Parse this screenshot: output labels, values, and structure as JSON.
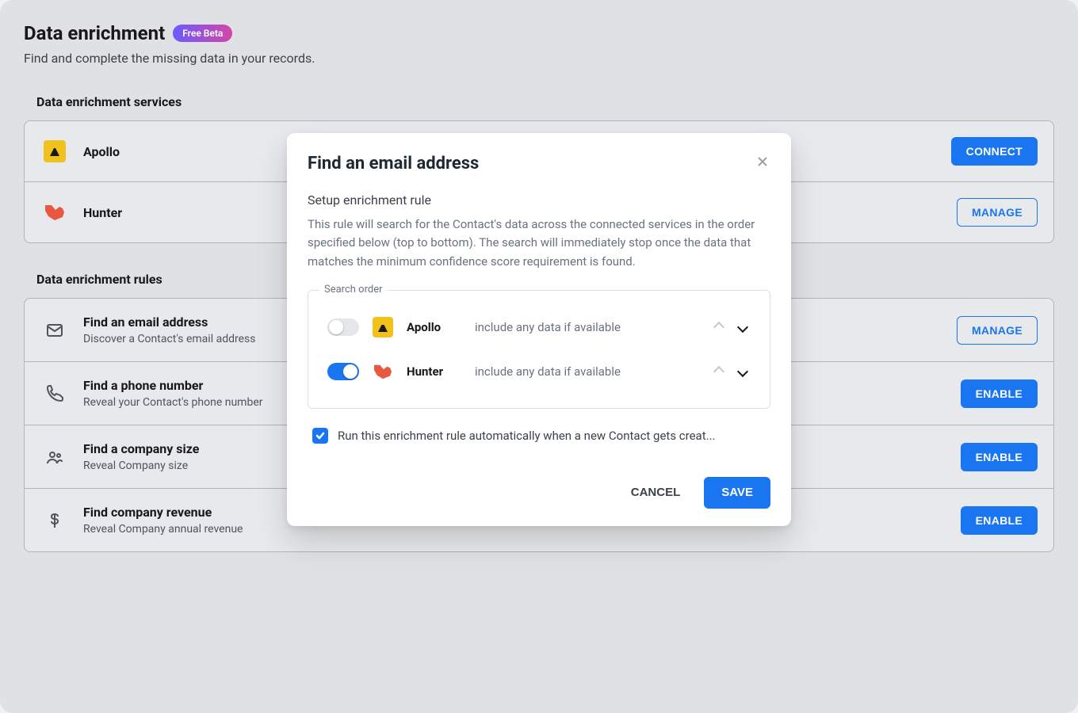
{
  "header": {
    "title": "Data enrichment",
    "badge": "Free Beta",
    "subtitle": "Find and complete the missing data in your records."
  },
  "services": {
    "section_title": "Data enrichment services",
    "items": [
      {
        "name": "Apollo",
        "action": "CONNECT",
        "action_style": "primary"
      },
      {
        "name": "Hunter",
        "action": "MANAGE",
        "action_style": "outline"
      }
    ]
  },
  "rules": {
    "section_title": "Data enrichment rules",
    "items": [
      {
        "name": "Find an email address",
        "desc": "Discover a Contact's email address",
        "action": "MANAGE",
        "action_style": "outline"
      },
      {
        "name": "Find a phone number",
        "desc": "Reveal your Contact's phone number",
        "action": "ENABLE",
        "action_style": "primary"
      },
      {
        "name": "Find a company size",
        "desc": "Reveal Company size",
        "action": "ENABLE",
        "action_style": "primary"
      },
      {
        "name": "Find company revenue",
        "desc": "Reveal Company annual revenue",
        "action": "ENABLE",
        "action_style": "primary"
      }
    ]
  },
  "modal": {
    "title": "Find an email address",
    "section_label": "Setup enrichment rule",
    "description": "This rule will search for the Contact's data across the connected services in the order specified below (top to bottom). The search will immediately stop once the data that matches the minimum confidence score requirement is found.",
    "fieldset_label": "Search order",
    "order": [
      {
        "enabled": false,
        "service": "Apollo",
        "note": "include any data if available",
        "can_up": false,
        "can_down": true
      },
      {
        "enabled": true,
        "service": "Hunter",
        "note": "include any data if available",
        "can_up": false,
        "can_down": true
      }
    ],
    "auto_run": {
      "checked": true,
      "label": "Run this enrichment rule automatically when a new Contact gets creat..."
    },
    "actions": {
      "cancel": "CANCEL",
      "save": "SAVE"
    }
  }
}
